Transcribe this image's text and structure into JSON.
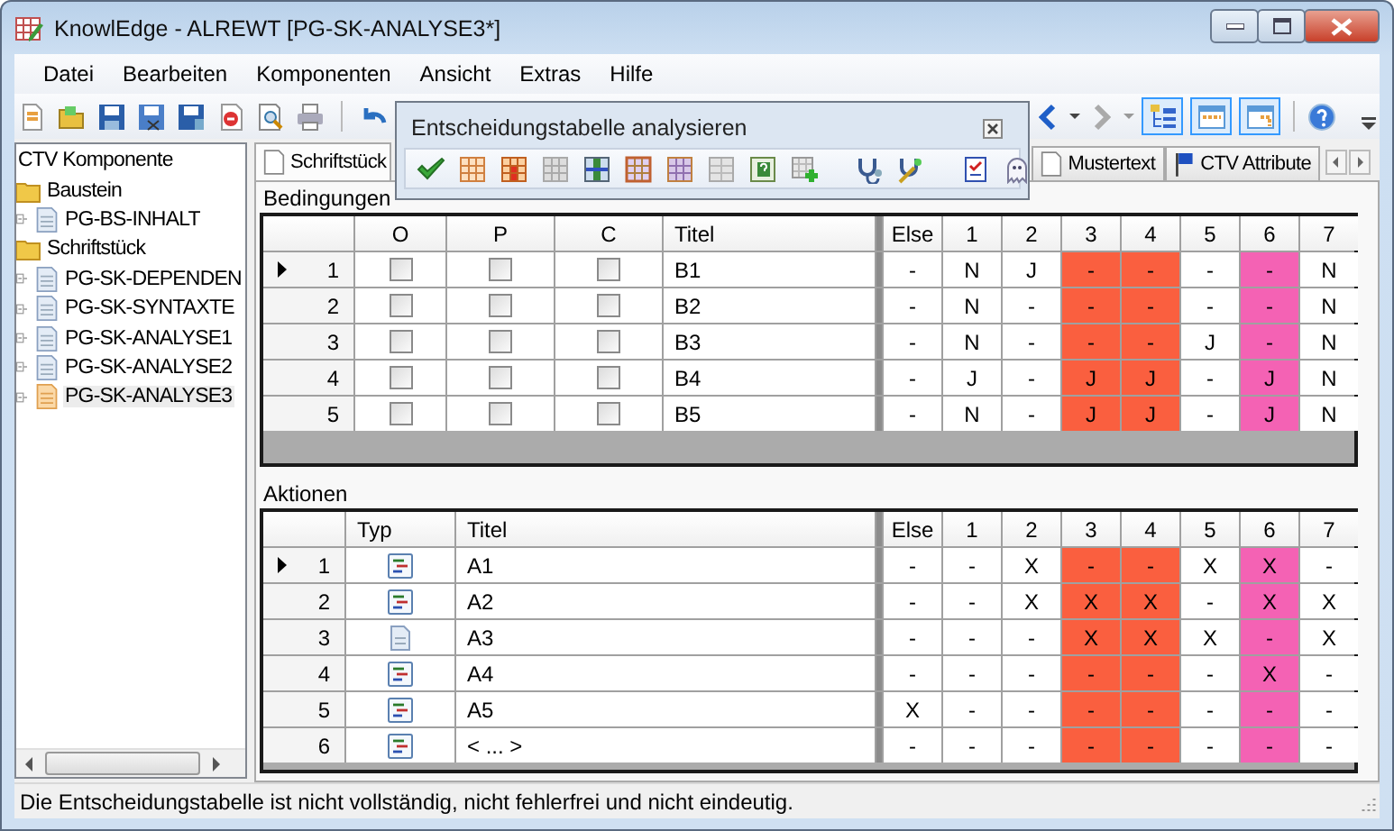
{
  "window": {
    "title": "KnowlEdge - ALREWT [PG-SK-ANALYSE3*]"
  },
  "menu": [
    "Datei",
    "Bearbeiten",
    "Komponenten",
    "Ansicht",
    "Extras",
    "Hilfe"
  ],
  "toolbar": {
    "view_toggles": [
      {
        "selected": true
      },
      {
        "selected": true
      },
      {
        "selected": true
      }
    ]
  },
  "floating_toolbar": {
    "title": "Entscheidungstabelle analysieren"
  },
  "tree": {
    "items": [
      {
        "label": "CTV Komponente",
        "selected": false,
        "children": [
          {
            "label": "Baustein",
            "kind": "folder",
            "selected": false,
            "children": [
              {
                "label": "PG-BS-INHALT",
                "kind": "document",
                "selected": false
              }
            ]
          },
          {
            "label": "Schriftstück",
            "kind": "folder",
            "selected": false,
            "children": [
              {
                "label": "PG-SK-DEPENDEN",
                "kind": "document",
                "selected": false
              },
              {
                "label": "PG-SK-SYNTAXTE",
                "kind": "document",
                "selected": false
              },
              {
                "label": "PG-SK-ANALYSE1",
                "kind": "document",
                "selected": false
              },
              {
                "label": "PG-SK-ANALYSE2",
                "kind": "document",
                "selected": false
              },
              {
                "label": "PG-SK-ANALYSE3",
                "kind": "document",
                "selected": true
              }
            ]
          }
        ]
      }
    ]
  },
  "tabs": [
    {
      "label": "Schriftstück",
      "kind": "document",
      "selected": true
    },
    {
      "label": "Mustertext",
      "kind": "document",
      "selected": false
    },
    {
      "label": "CTV Attribute",
      "kind": "flag",
      "selected": false
    }
  ],
  "conditions": {
    "title": "Bedingungen",
    "columns": [
      "O",
      "P",
      "C",
      "Titel"
    ],
    "rule_columns": [
      {
        "label": "Else",
        "color": "#ffffff"
      },
      {
        "label": "1",
        "color": "#ffffff"
      },
      {
        "label": "2",
        "color": "#ffffff"
      },
      {
        "label": "3",
        "color": "#fa5f3f"
      },
      {
        "label": "4",
        "color": "#fa5f3f"
      },
      {
        "label": "5",
        "color": "#ffffff"
      },
      {
        "label": "6",
        "color": "#f462b4"
      },
      {
        "label": "7",
        "color": "#ffffff"
      }
    ],
    "rows": [
      {
        "number": "1",
        "selected": true,
        "checks": [
          false,
          false,
          false
        ],
        "title": "B1",
        "values": [
          "-",
          "N",
          "J",
          "-",
          "-",
          "-",
          "-",
          "N"
        ]
      },
      {
        "number": "2",
        "selected": false,
        "checks": [
          false,
          false,
          false
        ],
        "title": "B2",
        "values": [
          "-",
          "N",
          "-",
          "-",
          "-",
          "-",
          "-",
          "N"
        ]
      },
      {
        "number": "3",
        "selected": false,
        "checks": [
          false,
          false,
          false
        ],
        "title": "B3",
        "values": [
          "-",
          "N",
          "-",
          "-",
          "-",
          "J",
          "-",
          "N"
        ]
      },
      {
        "number": "4",
        "selected": false,
        "checks": [
          false,
          false,
          false
        ],
        "title": "B4",
        "values": [
          "-",
          "J",
          "-",
          "J",
          "J",
          "-",
          "J",
          "N"
        ]
      },
      {
        "number": "5",
        "selected": false,
        "checks": [
          false,
          false,
          false
        ],
        "title": "B5",
        "values": [
          "-",
          "N",
          "-",
          "J",
          "J",
          "-",
          "J",
          "N"
        ]
      }
    ]
  },
  "actions": {
    "title": "Aktionen",
    "columns": [
      "Typ",
      "Titel"
    ],
    "rule_columns": [
      {
        "label": "Else",
        "color": "#ffffff"
      },
      {
        "label": "1",
        "color": "#ffffff"
      },
      {
        "label": "2",
        "color": "#ffffff"
      },
      {
        "label": "3",
        "color": "#fa5f3f"
      },
      {
        "label": "4",
        "color": "#fa5f3f"
      },
      {
        "label": "5",
        "color": "#ffffff"
      },
      {
        "label": "6",
        "color": "#f462b4"
      },
      {
        "label": "7",
        "color": "#ffffff"
      }
    ],
    "rows": [
      {
        "number": "1",
        "selected": true,
        "kind": "script",
        "title": "A1",
        "values": [
          "-",
          "-",
          "X",
          "-",
          "-",
          "X",
          "X",
          "-"
        ]
      },
      {
        "number": "2",
        "selected": false,
        "kind": "script",
        "title": "A2",
        "values": [
          "-",
          "-",
          "X",
          "X",
          "X",
          "-",
          "X",
          "X"
        ]
      },
      {
        "number": "3",
        "selected": false,
        "kind": "document",
        "title": "A3",
        "values": [
          "-",
          "-",
          "-",
          "X",
          "X",
          "X",
          "-",
          "X"
        ]
      },
      {
        "number": "4",
        "selected": false,
        "kind": "script",
        "title": "A4",
        "values": [
          "-",
          "-",
          "-",
          "-",
          "-",
          "-",
          "X",
          "-"
        ]
      },
      {
        "number": "5",
        "selected": false,
        "kind": "script",
        "title": "A5",
        "values": [
          "X",
          "-",
          "-",
          "-",
          "-",
          "-",
          "-",
          "-"
        ]
      },
      {
        "number": "6",
        "selected": false,
        "kind": "script",
        "title": "< ... >",
        "values": [
          "-",
          "-",
          "-",
          "-",
          "-",
          "-",
          "-",
          "-"
        ]
      }
    ]
  },
  "status_bar": "Die Entscheidungstabelle ist nicht vollständig, nicht fehlerfrei und nicht eindeutig."
}
